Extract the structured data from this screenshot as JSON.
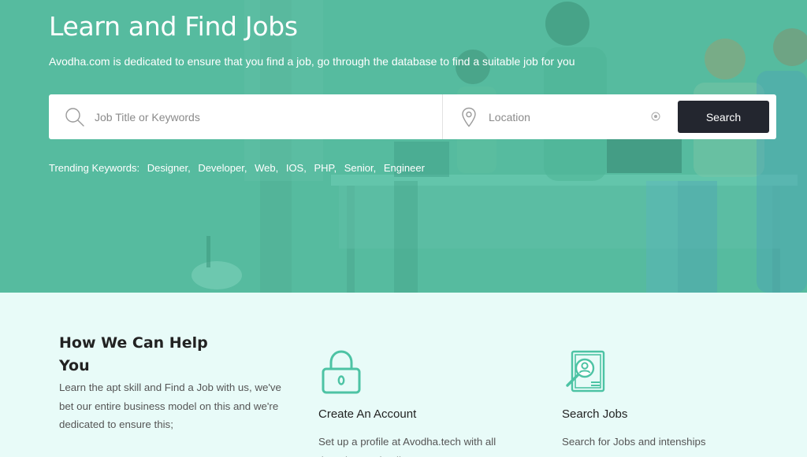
{
  "hero": {
    "title": "Learn and Find Jobs",
    "subtitle": "Avodha.com is dedicated to ensure that you find a job, go through the database to find a suitable job for you"
  },
  "search": {
    "keyword_placeholder": "Job Title or Keywords",
    "location_placeholder": "Location",
    "button_label": "Search"
  },
  "trending": {
    "label": "Trending Keywords:",
    "keywords": [
      "Designer,",
      "Developer,",
      "Web,",
      "IOS,",
      "PHP,",
      "Senior,",
      "Engineer"
    ]
  },
  "help": {
    "title": "How We Can Help You",
    "description": "Learn the apt skill and Find a Job with us, we've bet our entire business model on this and we're dedicated to ensure this;",
    "cards": [
      {
        "icon": "lock-icon",
        "title": "Create An Account",
        "description": "Set up a profile at Avodha.tech with all the relevant details"
      },
      {
        "icon": "resume-search-icon",
        "title": "Search Jobs",
        "description": "Search for Jobs and intenships"
      }
    ]
  },
  "colors": {
    "hero_bg": "#56bb9f",
    "section_bg": "#e8fbf8",
    "button_bg": "#23262f",
    "icon_accent": "#4dc3a4"
  }
}
